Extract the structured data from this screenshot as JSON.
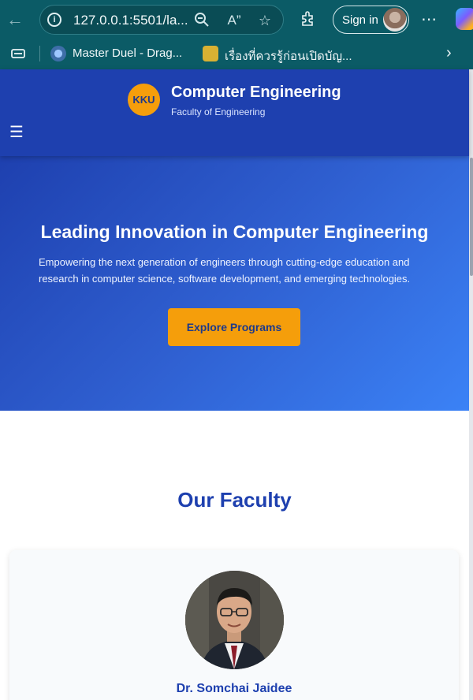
{
  "browser": {
    "url": "127.0.0.1:5501/la...",
    "sign_in_label": "Sign in",
    "favorites": [
      {
        "label": "Master Duel - Drag..."
      },
      {
        "label": "เรื่องที่ควรรู้ก่อนเปิดบัญ..."
      }
    ]
  },
  "header": {
    "logo_text": "KKU",
    "title": "Computer Engineering",
    "subtitle": "Faculty of Engineering"
  },
  "hero": {
    "title": "Leading Innovation in Computer Engineering",
    "text": "Empowering the next generation of engineers through cutting-edge education and research in computer science, software development, and emerging technologies.",
    "button_label": "Explore Programs"
  },
  "faculty": {
    "section_title": "Our Faculty",
    "members": [
      {
        "name": "Dr. Somchai Jaidee"
      }
    ]
  },
  "colors": {
    "header_bg": "#1e40af",
    "accent": "#f59e0b",
    "hero_gradient_end": "#3b82f6",
    "browser_chrome": "#0b5b66"
  }
}
